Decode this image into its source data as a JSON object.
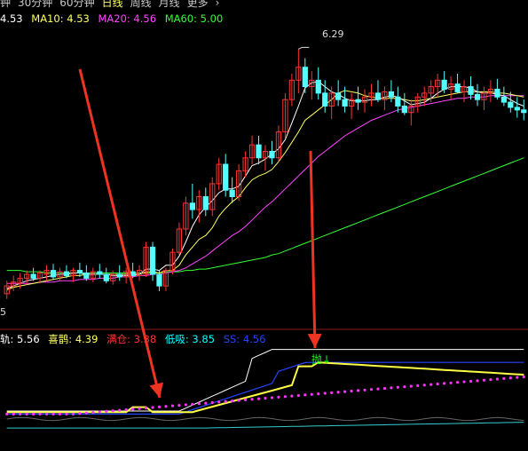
{
  "toolbar": {
    "items": [
      "钟",
      "30分钟",
      "60分钟",
      "日线",
      "周线",
      "月线",
      "更多",
      "›"
    ],
    "active_index": 3
  },
  "ma_legend": {
    "first": {
      "label": "4.53",
      "color": "#ffffff"
    },
    "ma10": {
      "label": "MA10: 4.53",
      "color": "#ffff66"
    },
    "ma20": {
      "label": "MA20: 4.56",
      "color": "#ff44ff"
    },
    "ma60": {
      "label": "MA60: 5.00",
      "color": "#33ff33"
    }
  },
  "high_label": "6.29",
  "low_label": "5",
  "indicator_legend": {
    "guidaoyu": {
      "label": "轨: 5.56",
      "color": "#ffffff"
    },
    "xique": {
      "label": "喜鹊: 4.39",
      "color": "#ffff66"
    },
    "mancang": {
      "label": "满仓: 3.38",
      "color": "#ff3333"
    },
    "dixi": {
      "label": "低吸: 3.85",
      "color": "#00ffff"
    },
    "ss": {
      "label": "SS: 4.56",
      "color": "#2244ff"
    }
  },
  "signal_label": "抛↓",
  "colors": {
    "up": "#ff3333",
    "down": "#54ffff",
    "arrow": "#ee3322"
  },
  "chart_data": {
    "type": "candlestick",
    "note_series": [
      "ma5_white",
      "ma10_yellow",
      "ma20_magenta",
      "ma60_green"
    ],
    "ohlc": [
      [
        4.4,
        4.5,
        4.36,
        4.46
      ],
      [
        4.46,
        4.54,
        4.42,
        4.49
      ],
      [
        4.48,
        4.56,
        4.44,
        4.52
      ],
      [
        4.52,
        4.58,
        4.47,
        4.55
      ],
      [
        4.55,
        4.6,
        4.5,
        4.52
      ],
      [
        4.52,
        4.58,
        4.48,
        4.56
      ],
      [
        4.55,
        4.62,
        4.5,
        4.58
      ],
      [
        4.58,
        4.63,
        4.51,
        4.53
      ],
      [
        4.53,
        4.6,
        4.5,
        4.57
      ],
      [
        4.57,
        4.62,
        4.52,
        4.54
      ],
      [
        4.54,
        4.6,
        4.49,
        4.58
      ],
      [
        4.58,
        4.64,
        4.53,
        4.56
      ],
      [
        4.56,
        4.62,
        4.5,
        4.52
      ],
      [
        4.52,
        4.6,
        4.49,
        4.57
      ],
      [
        4.57,
        4.63,
        4.52,
        4.55
      ],
      [
        4.55,
        4.6,
        4.48,
        4.5
      ],
      [
        4.5,
        4.58,
        4.47,
        4.55
      ],
      [
        4.55,
        4.62,
        4.5,
        4.53
      ],
      [
        4.53,
        4.6,
        4.48,
        4.57
      ],
      [
        4.57,
        4.64,
        4.52,
        4.54
      ],
      [
        4.54,
        4.62,
        4.5,
        4.58
      ],
      [
        4.55,
        4.8,
        4.53,
        4.76
      ],
      [
        4.76,
        4.8,
        4.5,
        4.55
      ],
      [
        4.55,
        4.58,
        4.42,
        4.46
      ],
      [
        4.46,
        4.6,
        4.42,
        4.58
      ],
      [
        4.58,
        4.75,
        4.55,
        4.72
      ],
      [
        4.72,
        4.95,
        4.7,
        4.9
      ],
      [
        4.9,
        5.15,
        4.85,
        5.1
      ],
      [
        5.1,
        5.25,
        4.98,
        5.05
      ],
      [
        5.05,
        5.2,
        4.95,
        5.15
      ],
      [
        5.15,
        5.22,
        5.0,
        5.05
      ],
      [
        5.05,
        5.3,
        5.0,
        5.25
      ],
      [
        5.25,
        5.45,
        5.2,
        5.4
      ],
      [
        5.4,
        5.48,
        5.15,
        5.2
      ],
      [
        5.2,
        5.3,
        5.1,
        5.15
      ],
      [
        5.15,
        5.4,
        5.12,
        5.35
      ],
      [
        5.35,
        5.5,
        5.3,
        5.45
      ],
      [
        5.45,
        5.62,
        5.4,
        5.55
      ],
      [
        5.55,
        5.62,
        5.4,
        5.45
      ],
      [
        5.45,
        5.55,
        5.35,
        5.5
      ],
      [
        5.5,
        5.58,
        5.4,
        5.45
      ],
      [
        5.45,
        5.7,
        5.42,
        5.65
      ],
      [
        5.65,
        5.95,
        5.6,
        5.9
      ],
      [
        5.9,
        6.1,
        5.85,
        6.05
      ],
      [
        6.05,
        6.29,
        5.95,
        6.15
      ],
      [
        6.15,
        6.22,
        5.95,
        6.0
      ],
      [
        6.0,
        6.12,
        5.9,
        6.05
      ],
      [
        6.05,
        6.15,
        5.9,
        5.95
      ],
      [
        5.95,
        6.05,
        5.8,
        5.85
      ],
      [
        5.85,
        6.0,
        5.75,
        5.95
      ],
      [
        5.95,
        6.05,
        5.85,
        5.9
      ],
      [
        5.9,
        6.0,
        5.8,
        5.85
      ],
      [
        5.85,
        5.95,
        5.75,
        5.9
      ],
      [
        5.9,
        6.0,
        5.82,
        5.88
      ],
      [
        5.88,
        5.98,
        5.8,
        5.92
      ],
      [
        5.92,
        6.02,
        5.85,
        5.95
      ],
      [
        5.95,
        6.05,
        5.88,
        5.9
      ],
      [
        5.9,
        6.0,
        5.82,
        5.96
      ],
      [
        5.96,
        6.05,
        5.88,
        5.92
      ],
      [
        5.92,
        6.0,
        5.8,
        5.85
      ],
      [
        5.85,
        5.95,
        5.78,
        5.8
      ],
      [
        5.8,
        5.9,
        5.7,
        5.85
      ],
      [
        5.85,
        5.95,
        5.8,
        5.92
      ],
      [
        5.92,
        6.0,
        5.85,
        5.95
      ],
      [
        5.95,
        6.05,
        5.88,
        6.0
      ],
      [
        6.0,
        6.1,
        5.92,
        6.05
      ],
      [
        6.05,
        6.12,
        5.95,
        5.98
      ],
      [
        5.98,
        6.08,
        5.9,
        6.02
      ],
      [
        6.02,
        6.1,
        5.95,
        5.96
      ],
      [
        5.96,
        6.05,
        5.88,
        6.0
      ],
      [
        6.0,
        6.08,
        5.9,
        5.94
      ],
      [
        5.94,
        6.02,
        5.85,
        5.9
      ],
      [
        5.9,
        6.0,
        5.82,
        5.95
      ],
      [
        5.95,
        6.05,
        5.88,
        5.98
      ],
      [
        5.98,
        6.06,
        5.9,
        5.92
      ],
      [
        5.92,
        6.0,
        5.85,
        5.88
      ],
      [
        5.88,
        5.96,
        5.8,
        5.84
      ],
      [
        5.84,
        5.92,
        5.76,
        5.82
      ],
      [
        5.82,
        5.9,
        5.74,
        5.8
      ]
    ],
    "ma5_white": [
      4.44,
      4.46,
      4.48,
      4.5,
      4.51,
      4.52,
      4.53,
      4.54,
      4.55,
      4.55,
      4.56,
      4.56,
      4.55,
      4.55,
      4.55,
      4.55,
      4.54,
      4.54,
      4.54,
      4.54,
      4.55,
      4.59,
      4.59,
      4.58,
      4.62,
      4.62,
      4.69,
      4.8,
      4.92,
      5.01,
      5.07,
      5.12,
      5.18,
      5.21,
      5.21,
      5.23,
      5.31,
      5.39,
      5.41,
      5.44,
      5.48,
      5.52,
      5.59,
      5.72,
      5.85,
      5.99,
      6.03,
      6.04,
      6.0,
      5.96,
      5.94,
      5.91,
      5.89,
      5.89,
      5.89,
      5.9,
      5.9,
      5.92,
      5.93,
      5.92,
      5.89,
      5.86,
      5.87,
      5.88,
      5.91,
      5.95,
      5.98,
      6.0,
      6.0,
      6.0,
      5.99,
      5.96,
      5.95,
      5.95,
      5.94,
      5.93,
      5.9,
      5.87,
      5.85
    ],
    "ma10_yellow": [
      4.43,
      4.45,
      4.46,
      4.47,
      4.48,
      4.49,
      4.5,
      4.51,
      4.52,
      4.53,
      4.54,
      4.54,
      4.55,
      4.55,
      4.55,
      4.55,
      4.55,
      4.55,
      4.55,
      4.55,
      4.55,
      4.57,
      4.57,
      4.56,
      4.58,
      4.58,
      4.62,
      4.7,
      4.76,
      4.82,
      4.85,
      4.91,
      5.0,
      5.06,
      5.11,
      5.15,
      5.22,
      5.28,
      5.31,
      5.33,
      5.36,
      5.42,
      5.49,
      5.57,
      5.65,
      5.74,
      5.78,
      5.82,
      5.86,
      5.9,
      5.95,
      5.97,
      5.96,
      5.95,
      5.93,
      5.92,
      5.91,
      5.91,
      5.91,
      5.91,
      5.9,
      5.89,
      5.89,
      5.9,
      5.91,
      5.92,
      5.93,
      5.94,
      5.95,
      5.96,
      5.96,
      5.96,
      5.96,
      5.96,
      5.95,
      5.95,
      5.94,
      5.93,
      5.92
    ],
    "ma20_magenta": [
      4.48,
      4.48,
      4.48,
      4.48,
      4.48,
      4.49,
      4.49,
      4.49,
      4.5,
      4.5,
      4.5,
      4.51,
      4.51,
      4.51,
      4.52,
      4.52,
      4.52,
      4.53,
      4.53,
      4.53,
      4.54,
      4.54,
      4.55,
      4.55,
      4.56,
      4.57,
      4.58,
      4.6,
      4.63,
      4.66,
      4.69,
      4.73,
      4.77,
      4.81,
      4.85,
      4.88,
      4.92,
      4.97,
      5.02,
      5.07,
      5.11,
      5.16,
      5.21,
      5.26,
      5.31,
      5.36,
      5.41,
      5.46,
      5.5,
      5.54,
      5.58,
      5.62,
      5.65,
      5.68,
      5.71,
      5.74,
      5.76,
      5.78,
      5.8,
      5.82,
      5.83,
      5.84,
      5.85,
      5.86,
      5.87,
      5.88,
      5.89,
      5.9,
      5.91,
      5.91,
      5.92,
      5.92,
      5.92,
      5.93,
      5.93,
      5.93,
      5.93,
      5.93,
      5.93
    ],
    "ma60_green": [
      4.58,
      4.58,
      4.58,
      4.57,
      4.57,
      4.57,
      4.56,
      4.56,
      4.56,
      4.56,
      4.56,
      4.56,
      4.56,
      4.56,
      4.56,
      4.56,
      4.56,
      4.56,
      4.56,
      4.56,
      4.56,
      4.56,
      4.56,
      4.56,
      4.57,
      4.57,
      4.57,
      4.58,
      4.58,
      4.59,
      4.59,
      4.6,
      4.61,
      4.62,
      4.63,
      4.64,
      4.65,
      4.66,
      4.67,
      4.68,
      4.7,
      4.71,
      4.73,
      4.75,
      4.77,
      4.79,
      4.81,
      4.83,
      4.85,
      4.87,
      4.89,
      4.91,
      4.93,
      4.95,
      4.97,
      4.99,
      5.01,
      5.03,
      5.05,
      5.07,
      5.09,
      5.11,
      5.13,
      5.15,
      5.17,
      5.19,
      5.21,
      5.23,
      5.25,
      5.27,
      5.29,
      5.31,
      5.33,
      5.35,
      5.37,
      5.39,
      5.41,
      5.43,
      5.45
    ],
    "price_range": [
      4.2,
      6.45
    ]
  }
}
